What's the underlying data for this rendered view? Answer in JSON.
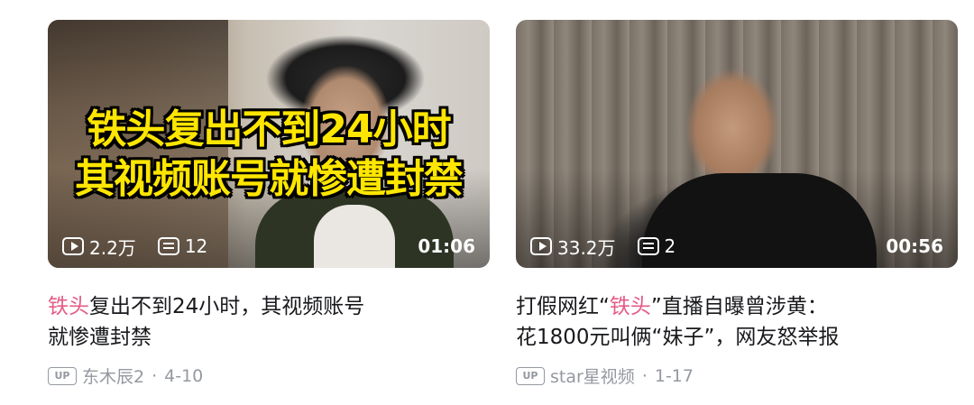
{
  "cards": [
    {
      "thumb_line1": "铁头复出不到24小时",
      "thumb_line2": "其视频账号就惨遭封禁",
      "views": "2.2万",
      "comments": "12",
      "duration": "01:06",
      "title_hl": "铁头",
      "title_rest1": "复出不到24小时，其视频账号",
      "title_line2": "就惨遭封禁",
      "up_badge": "UP",
      "author": "东木辰2",
      "dot": "·",
      "date": "4-10"
    },
    {
      "views": "33.2万",
      "comments": "2",
      "duration": "00:56",
      "title_pre": "打假网红“",
      "title_hl": "铁头",
      "title_rest1": "”直播自曝曾涉黄：",
      "title_line2": "花1800元叫俩“妹子”，网友怒举报",
      "up_badge": "UP",
      "author": "star星视频",
      "dot": "·",
      "date": "1-17"
    }
  ],
  "icons": {
    "views": "play-count-icon",
    "comments": "danmaku-icon"
  },
  "colors": {
    "highlight": "#e45c87",
    "title": "#18191c",
    "meta": "#9499a0",
    "overlay_text": "#ffe600"
  }
}
